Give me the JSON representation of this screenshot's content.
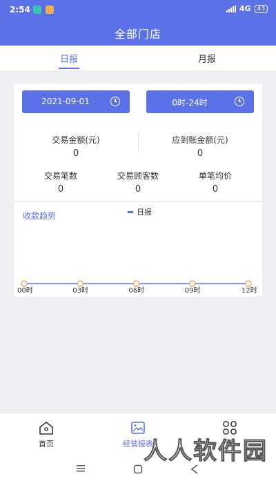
{
  "status_bar": {
    "time": "2:54",
    "network": "4G",
    "battery": "43"
  },
  "header": {
    "title": "全部门店"
  },
  "tabs": [
    {
      "label": "日报",
      "active": true
    },
    {
      "label": "月报",
      "active": false
    }
  ],
  "filters": {
    "date": "2021-09-01",
    "time_range": "0时-24时",
    "date_icon": "clock-icon",
    "time_icon": "clock-icon"
  },
  "stats": {
    "transaction_amount": {
      "label": "交易金额(元)",
      "value": "0"
    },
    "settled_amount": {
      "label": "应到账金额(元)",
      "value": "0"
    },
    "transaction_count": {
      "label": "交易笔数",
      "value": "0"
    },
    "customer_count": {
      "label": "交易顾客数",
      "value": "0"
    },
    "avg_price": {
      "label": "单笔均价",
      "value": "0"
    }
  },
  "chart_title": "收款趋势",
  "chart_data": {
    "type": "line",
    "categories": [
      "00时",
      "03时",
      "06时",
      "09时",
      "12时"
    ],
    "series": [
      {
        "name": "日报",
        "values": [
          0,
          0,
          0,
          0,
          0
        ]
      }
    ],
    "xlabel": "",
    "ylabel": "",
    "grid": false,
    "legend": "top-center",
    "colors": {
      "line": "#5b71e8",
      "point_stroke": "#f0a868"
    }
  },
  "bottom_nav": [
    {
      "label": "首页",
      "icon": "home-icon",
      "active": false
    },
    {
      "label": "经营报表",
      "icon": "image-icon",
      "active": true
    },
    {
      "label": "我",
      "icon": "grid-icon",
      "active": false
    }
  ],
  "watermark": "人人软件园",
  "colors": {
    "primary": "#5b71e8",
    "background": "#eeeff3"
  }
}
